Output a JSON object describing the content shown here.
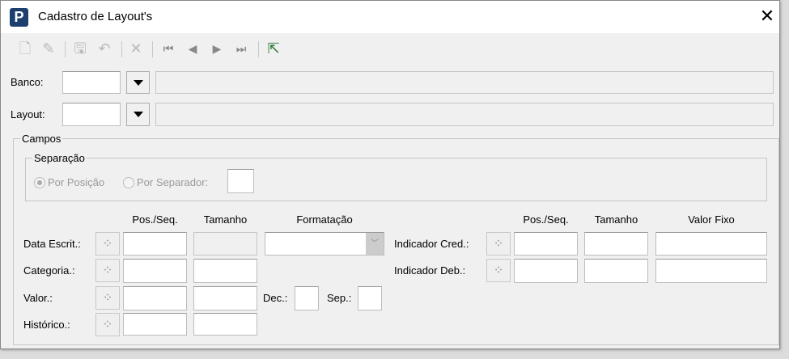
{
  "window": {
    "title": "Cadastro de Layout's",
    "logo": "P"
  },
  "toolbar": {
    "icons": [
      "new-icon",
      "edit-icon",
      "save-icon",
      "undo-icon",
      "delete-icon",
      "first-icon",
      "previous-icon",
      "next-icon",
      "last-icon",
      "import-icon"
    ]
  },
  "banco": {
    "label": "Banco:",
    "code": "",
    "description": ""
  },
  "layout": {
    "label": "Layout:",
    "code": "",
    "description": ""
  },
  "campos": {
    "legend": "Campos",
    "separacao": {
      "legend": "Separação",
      "por_posicao": "Por Posição",
      "por_separador": "Por Separador:",
      "selected": "por_posicao",
      "separator_value": ""
    },
    "headers_left": {
      "pos": "Pos./Seq.",
      "tamanho": "Tamanho",
      "formatacao": "Formatação"
    },
    "headers_right": {
      "pos": "Pos./Seq.",
      "tamanho": "Tamanho",
      "valor_fixo": "Valor Fixo"
    },
    "rows_left": [
      {
        "label": "Data Escrit.:"
      },
      {
        "label": "Categoria.:"
      },
      {
        "label": "Valor.:"
      },
      {
        "label": "Histórico.:"
      }
    ],
    "rows_right": [
      {
        "label": "Indicador Cred.:"
      },
      {
        "label": "Indicador Deb.:"
      }
    ],
    "dec_label": "Dec.:",
    "sep_label": "Sep.:"
  }
}
